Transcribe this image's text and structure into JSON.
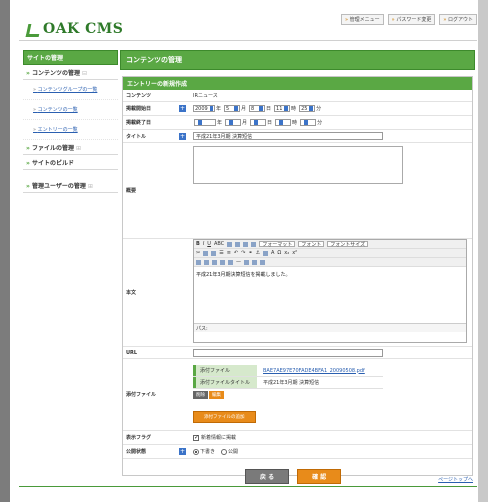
{
  "logo": {
    "text": "OAK CMS"
  },
  "toplinks": [
    "管理メニュー",
    "パスワード変更",
    "ログアウト"
  ],
  "sidebar": {
    "site_head": "サイトの管理",
    "contents": "コンテンツの管理",
    "sub": [
      "コンテンツグループの一覧",
      "コンテンツの一覧",
      "エントリーの一覧"
    ],
    "files": "ファイルの管理",
    "build": "サイトのビルド",
    "admin": "管理ユーザーの管理"
  },
  "main": {
    "title": "コンテンツの管理",
    "panel_title": "エントリーの新規作成",
    "content_label": "コンテンツ",
    "content_value": "IRニュース",
    "start_label": "掲載開始日",
    "start": {
      "year": "2009",
      "month": "5",
      "day": "8",
      "hour": "11",
      "min": "25"
    },
    "end_label": "掲載終了日",
    "units": {
      "year": "年",
      "month": "月",
      "day": "日",
      "hour": "時",
      "min": "分"
    },
    "title_label": "タイトル",
    "title_value": "平成21年3月期 決算短信",
    "summary_label": "概要",
    "body_label": "本文",
    "body_text": "平成21年3月期決算短信を掲載しました。",
    "toolbar": {
      "format": "フォーマット",
      "font": "フォント",
      "size": "フォントサイズ"
    },
    "path_label": "パス:",
    "url_label": "URL",
    "attach_label": "添付ファイル",
    "attach_file_label": "添付ファイル",
    "attach_file_value": "BAE7AE97E70FADE4BFA1_20090508.pdf",
    "attach_title_label": "添付ファイルタイトル",
    "attach_title_value": "平成21年3月期 決算短信",
    "del_btn": "削除",
    "edit_btn": "編集",
    "add_attach_btn": "添付ファイルの追加",
    "flag_label": "表示フラグ",
    "flag_text": "新着情報に掲載",
    "status_label": "公開状態",
    "status_draft": "下書き",
    "status_public": "公開",
    "back_btn": "戻 る",
    "confirm_btn": "確 認",
    "pagetop": "ページトップへ"
  },
  "colors": {
    "green": "#5aa844",
    "orange": "#e88b1a",
    "link": "#2a5fb0"
  }
}
